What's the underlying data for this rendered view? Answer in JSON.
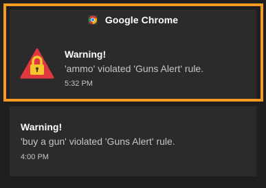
{
  "notifications": [
    {
      "app_name": "Google Chrome",
      "app_icon": "chrome-icon",
      "title": "Warning!",
      "message": "'ammo' violated 'Guns Alert' rule.",
      "time": "5:32 PM",
      "icon": "warning-lock-icon",
      "highlighted": true
    },
    {
      "title": "Warning!",
      "message": "'buy a gun' violated 'Guns Alert' rule.",
      "time": "4:00 PM"
    }
  ],
  "colors": {
    "background": "#1f1f1f",
    "card": "#2b2b2b",
    "highlight": "#f59a23",
    "warning_red": "#e0383e",
    "lock_yellow": "#f6c62f"
  }
}
